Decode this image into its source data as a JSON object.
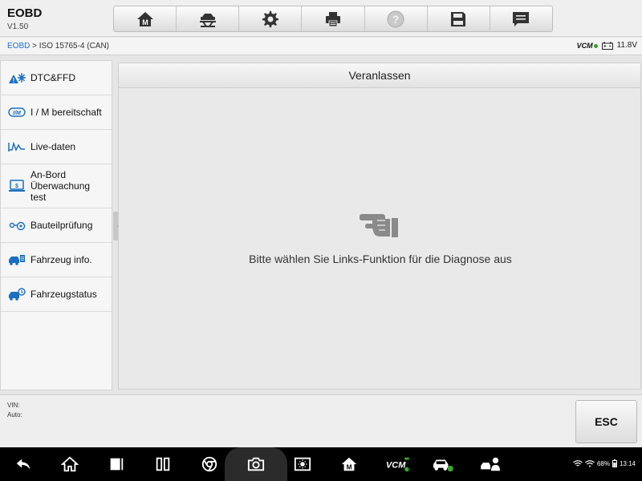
{
  "app": {
    "title": "EOBD",
    "version": "V1.50"
  },
  "toolbar": {
    "buttons": [
      {
        "name": "home-m",
        "icon": "home-m-icon"
      },
      {
        "name": "vehicle",
        "icon": "car-lift-icon"
      },
      {
        "name": "settings",
        "icon": "gear-icon"
      },
      {
        "name": "print",
        "icon": "printer-icon"
      },
      {
        "name": "help",
        "icon": "help-icon"
      },
      {
        "name": "save",
        "icon": "floppy-icon"
      },
      {
        "name": "message",
        "icon": "chat-icon"
      }
    ]
  },
  "breadcrumb": {
    "root": "EOBD",
    "separator": " > ",
    "current": "ISO 15765-4 (CAN)"
  },
  "status": {
    "vcm": "VCM",
    "voltage": "11.8V"
  },
  "sidebar": {
    "items": [
      {
        "label": "DTC&FFD",
        "icon": "dtc-icon"
      },
      {
        "label": "I / M bereitschaft",
        "icon": "im-icon"
      },
      {
        "label": "Live-daten",
        "icon": "live-data-icon"
      },
      {
        "label": "An-Bord Überwachung test",
        "icon": "monitor-icon"
      },
      {
        "label": "Bauteilprüfung",
        "icon": "component-test-icon"
      },
      {
        "label": "Fahrzeug info.",
        "icon": "vehicle-info-icon"
      },
      {
        "label": "Fahrzeugstatus",
        "icon": "vehicle-status-icon"
      }
    ]
  },
  "main": {
    "header": "Veranlassen",
    "instruction": "Bitte wählen Sie Links-Funktion für die Diagnose aus"
  },
  "bottom": {
    "vin_label": "VIN:",
    "auto_label": "Auto:",
    "esc_label": "ESC"
  },
  "systembar": {
    "battery": "68%",
    "time": "13:14"
  },
  "colors": {
    "accent": "#1f73c8",
    "icon_blue": "#1a6fc0",
    "background": "#e6e6e6",
    "navbar": "#000000"
  }
}
